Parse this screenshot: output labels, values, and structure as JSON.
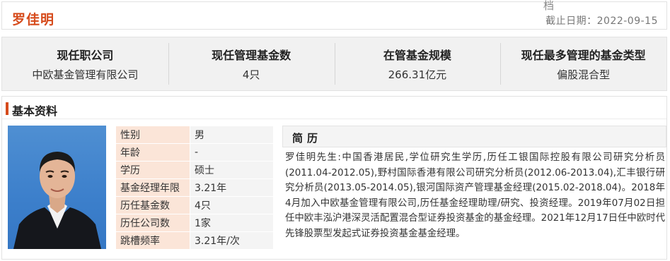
{
  "header": {
    "manager_name": "罗佳明",
    "archive_char": "档",
    "as_of_date": "截止日期：2022-09-15"
  },
  "stats": [
    {
      "label": "现任职公司",
      "value": "中欧基金管理有限公司"
    },
    {
      "label": "现任管理基金数",
      "value": "4只"
    },
    {
      "label": "在管基金规模",
      "value": "266.31亿元"
    },
    {
      "label": "现任最多管理的基金类型",
      "value": "偏股混合型"
    }
  ],
  "basic": {
    "title": "基本资料",
    "rows": [
      {
        "key": "性别",
        "value": "男"
      },
      {
        "key": "年龄",
        "value": "-"
      },
      {
        "key": "学历",
        "value": "硕士"
      },
      {
        "key": "基金经理年限",
        "value": "3.21年"
      },
      {
        "key": "历任基金数",
        "value": "4只"
      },
      {
        "key": "历任公司数",
        "value": "1家"
      },
      {
        "key": "跳槽频率",
        "value": "3.21年/次"
      }
    ],
    "bio_title": "简历",
    "bio_text": "罗佳明先生:中国香港居民,学位研究生学历,历任工银国际控股有限公司研究分析员(2011.04-2012.05),野村国际香港有限公司研究分析员(2012.06-2013.04),汇丰银行研究分析员(2013.05-2014.05),银河国际资产管理基金经理(2015.02-2018.04)。2018年4月加入中欧基金管理有限公司,历任基金经理助理/研究、投资经理。2019年07月02日担任中欧丰泓沪港深灵活配置混合型证券投资基金的基金经理。2021年12月17日任中欧时代先锋股票型发起式证券投资基金基金经理。"
  },
  "colors": {
    "accent": "#d64b1c",
    "key_bg": "#fbe5d8",
    "value_bg": "#f4f4f4",
    "photo_bg": "#4f8fd2"
  }
}
